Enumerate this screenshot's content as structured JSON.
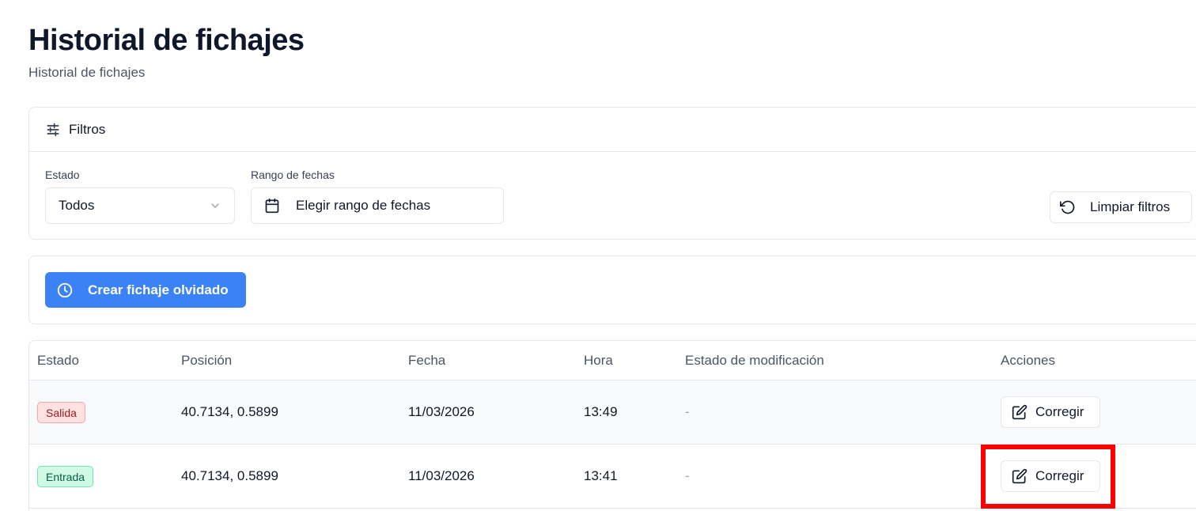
{
  "header": {
    "title": "Historial de fichajes",
    "subtitle": "Historial de fichajes"
  },
  "filters": {
    "title": "Filtros",
    "estado_label": "Estado",
    "estado_value": "Todos",
    "rango_label": "Rango de fechas",
    "rango_placeholder": "Elegir rango de fechas",
    "clear_label": "Limpiar filtros"
  },
  "actions": {
    "create_label": "Crear fichaje olvidado"
  },
  "table": {
    "columns": [
      "Estado",
      "Posición",
      "Fecha",
      "Hora",
      "Estado de modificación",
      "Acciones"
    ],
    "rows": [
      {
        "estado": "Salida",
        "estado_kind": "out",
        "posicion": "40.7134, 0.5899",
        "fecha": "11/03/2026",
        "hora": "13:49",
        "modificacion": "-",
        "accion": "Corregir"
      },
      {
        "estado": "Entrada",
        "estado_kind": "in",
        "posicion": "40.7134, 0.5899",
        "fecha": "11/03/2026",
        "hora": "13:41",
        "modificacion": "-",
        "accion": "Corregir"
      }
    ]
  },
  "colors": {
    "primary": "#3b82f6",
    "highlight": "#ff0000",
    "badge_out_bg": "#fee2e2",
    "badge_in_bg": "#d1fae5"
  },
  "icons": {
    "filters": "sliders-icon",
    "select": "chevron-down-icon",
    "date": "calendar-icon",
    "clear": "rotate-ccw-icon",
    "create": "clock-icon",
    "fix": "edit-icon"
  }
}
